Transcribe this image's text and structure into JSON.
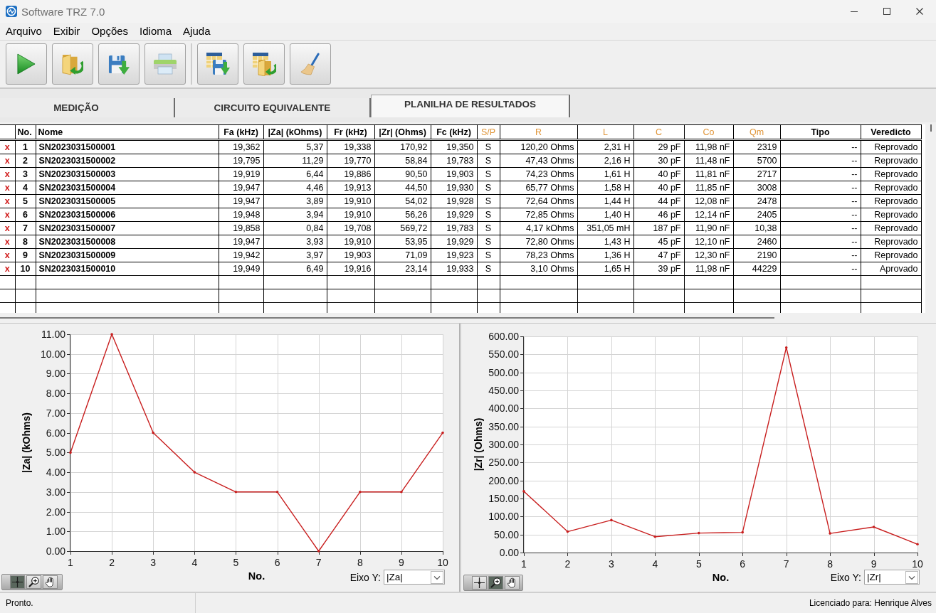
{
  "window": {
    "title": "Software TRZ 7.0"
  },
  "menu": [
    "Arquivo",
    "Exibir",
    "Opções",
    "Idioma",
    "Ajuda"
  ],
  "tabs": [
    {
      "label": "MEDIÇÃO",
      "selected": false
    },
    {
      "label": "CIRCUITO EQUIVALENTE",
      "selected": false
    },
    {
      "label": "PLANILHA DE RESULTADOS",
      "selected": true
    }
  ],
  "table": {
    "columns": [
      {
        "label": "No."
      },
      {
        "label": "Nome"
      },
      {
        "label": "Fa (kHz)"
      },
      {
        "label": "|Za| (kOhms)"
      },
      {
        "label": "Fr (kHz)"
      },
      {
        "label": "|Zr| (Ohms)"
      },
      {
        "label": "Fc (kHz)"
      },
      {
        "label": "S/P",
        "color": "#e0963a"
      },
      {
        "label": "R",
        "color": "#e0963a"
      },
      {
        "label": "L",
        "color": "#e0963a"
      },
      {
        "label": "C",
        "color": "#e0963a"
      },
      {
        "label": "Co",
        "color": "#e0963a"
      },
      {
        "label": "Qm",
        "color": "#e0963a"
      },
      {
        "label": "Tipo"
      },
      {
        "label": "Veredicto"
      }
    ],
    "rows": [
      {
        "flag": "x",
        "cells": [
          "1",
          "SN2023031500001",
          "19,362",
          "5,37",
          "19,338",
          "170,92",
          "19,350",
          "S",
          "120,20 Ohms",
          "2,31 H",
          "29 pF",
          "11,98 nF",
          "2319",
          "--",
          "Reprovado"
        ]
      },
      {
        "flag": "x",
        "cells": [
          "2",
          "SN2023031500002",
          "19,795",
          "11,29",
          "19,770",
          "58,84",
          "19,783",
          "S",
          "47,43 Ohms",
          "2,16 H",
          "30 pF",
          "11,48 nF",
          "5700",
          "--",
          "Reprovado"
        ]
      },
      {
        "flag": "x",
        "cells": [
          "3",
          "SN2023031500003",
          "19,919",
          "6,44",
          "19,886",
          "90,50",
          "19,903",
          "S",
          "74,23 Ohms",
          "1,61 H",
          "40 pF",
          "11,81 nF",
          "2717",
          "--",
          "Reprovado"
        ]
      },
      {
        "flag": "x",
        "cells": [
          "4",
          "SN2023031500004",
          "19,947",
          "4,46",
          "19,913",
          "44,50",
          "19,930",
          "S",
          "65,77 Ohms",
          "1,58 H",
          "40 pF",
          "11,85 nF",
          "3008",
          "--",
          "Reprovado"
        ]
      },
      {
        "flag": "x",
        "cells": [
          "5",
          "SN2023031500005",
          "19,947",
          "3,89",
          "19,910",
          "54,02",
          "19,928",
          "S",
          "72,64 Ohms",
          "1,44 H",
          "44 pF",
          "12,08 nF",
          "2478",
          "--",
          "Reprovado"
        ]
      },
      {
        "flag": "x",
        "cells": [
          "6",
          "SN2023031500006",
          "19,948",
          "3,94",
          "19,910",
          "56,26",
          "19,929",
          "S",
          "72,85 Ohms",
          "1,40 H",
          "46 pF",
          "12,14 nF",
          "2405",
          "--",
          "Reprovado"
        ]
      },
      {
        "flag": "x",
        "cells": [
          "7",
          "SN2023031500007",
          "19,858",
          "0,84",
          "19,708",
          "569,72",
          "19,783",
          "S",
          "4,17 kOhms",
          "351,05 mH",
          "187 pF",
          "11,90 nF",
          "10,38",
          "--",
          "Reprovado"
        ]
      },
      {
        "flag": "x",
        "cells": [
          "8",
          "SN2023031500008",
          "19,947",
          "3,93",
          "19,910",
          "53,95",
          "19,929",
          "S",
          "72,80 Ohms",
          "1,43 H",
          "45 pF",
          "12,10 nF",
          "2460",
          "--",
          "Reprovado"
        ]
      },
      {
        "flag": "x",
        "cells": [
          "9",
          "SN2023031500009",
          "19,942",
          "3,97",
          "19,903",
          "71,09",
          "19,923",
          "S",
          "78,23 Ohms",
          "1,36 H",
          "47 pF",
          "12,30 nF",
          "2190",
          "--",
          "Reprovado"
        ]
      },
      {
        "flag": "x",
        "cells": [
          "10",
          "SN2023031500010",
          "19,949",
          "6,49",
          "19,916",
          "23,14",
          "19,933",
          "S",
          "3,10 Ohms",
          "1,65 H",
          "39 pF",
          "11,98 nF",
          "44229",
          "--",
          "Aprovado"
        ]
      }
    ]
  },
  "charts": [
    {
      "chart_data": {
        "type": "line",
        "xlabel": "No.",
        "ylabel": "|Za| (kOhms)",
        "x": [
          1,
          2,
          3,
          4,
          5,
          6,
          7,
          8,
          9,
          10
        ],
        "series": [
          {
            "color": "#c81e1e",
            "values": [
              5,
              11,
              6,
              4,
              3,
              3,
              0,
              3,
              3,
              6
            ]
          }
        ],
        "xlim": [
          1,
          10
        ],
        "ylim": [
          0,
          11
        ],
        "xticks": [
          1,
          2,
          3,
          4,
          5,
          6,
          7,
          8,
          9,
          10
        ],
        "yticks": [
          {
            "value": 0,
            "label": "0.00"
          },
          {
            "value": 1,
            "label": "1.00"
          },
          {
            "value": 2,
            "label": "2.00"
          },
          {
            "value": 3,
            "label": "3.00"
          },
          {
            "value": 4,
            "label": "4.00"
          },
          {
            "value": 5,
            "label": "5.00"
          },
          {
            "value": 6,
            "label": "6.00"
          },
          {
            "value": 7,
            "label": "7.00"
          },
          {
            "value": 8,
            "label": "8.00"
          },
          {
            "value": 9,
            "label": "9.00"
          },
          {
            "value": 10,
            "label": "10.00"
          },
          {
            "value": 11,
            "label": "11.00"
          }
        ],
        "grid": true
      },
      "palette": [
        {
          "kind": "cursor",
          "selected": true
        },
        {
          "kind": "zoom",
          "selected": false
        },
        {
          "kind": "pan",
          "selected": false
        }
      ],
      "axis_selector": {
        "label": "Eixo Y:",
        "value": "|Za|"
      }
    },
    {
      "chart_data": {
        "type": "line",
        "xlabel": "No.",
        "ylabel": "|Zr| (Ohms)",
        "x": [
          1,
          2,
          3,
          4,
          5,
          6,
          7,
          8,
          9,
          10
        ],
        "series": [
          {
            "color": "#c81e1e",
            "values": [
              170,
              58,
              90,
              44,
              54,
              56,
              569,
              53,
              71,
              23
            ]
          }
        ],
        "xlim": [
          1,
          10
        ],
        "ylim": [
          0,
          600
        ],
        "xticks": [
          1,
          2,
          3,
          4,
          5,
          6,
          7,
          8,
          9,
          10
        ],
        "yticks": [
          {
            "value": 0,
            "label": "0.00"
          },
          {
            "value": 50,
            "label": "50.00"
          },
          {
            "value": 100,
            "label": "100.00"
          },
          {
            "value": 150,
            "label": "150.00"
          },
          {
            "value": 200,
            "label": "200.00"
          },
          {
            "value": 250,
            "label": "250.00"
          },
          {
            "value": 300,
            "label": "300.00"
          },
          {
            "value": 350,
            "label": "350.00"
          },
          {
            "value": 400,
            "label": "400.00"
          },
          {
            "value": 450,
            "label": "450.00"
          },
          {
            "value": 500,
            "label": "500.00"
          },
          {
            "value": 550,
            "label": "550.00"
          },
          {
            "value": 600,
            "label": "600.00"
          }
        ],
        "grid": true
      },
      "palette": [
        {
          "kind": "cursor",
          "selected": false
        },
        {
          "kind": "zoom",
          "selected": true
        },
        {
          "kind": "pan",
          "selected": false
        }
      ],
      "axis_selector": {
        "label": "Eixo Y:",
        "value": "|Zr|"
      }
    }
  ],
  "status_bar": {
    "message": "Pronto.",
    "license": "Licenciado para: Henrique Alves"
  }
}
